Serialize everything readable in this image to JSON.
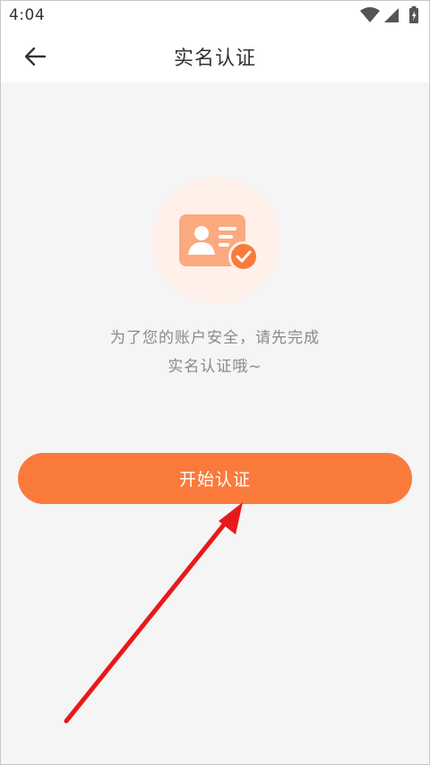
{
  "status_bar": {
    "time": "4:04",
    "icons": [
      "wifi-icon",
      "signal-icon",
      "battery-icon"
    ]
  },
  "nav": {
    "title": "实名认证",
    "back_icon": "arrow-left-icon"
  },
  "hero": {
    "icon": "id-card-check-icon"
  },
  "message": {
    "line1": "为了您的账户安全，请先完成",
    "line2": "实名认证哦~"
  },
  "actions": {
    "start_label": "开始认证"
  },
  "colors": {
    "accent": "#fa7a3c",
    "icon_circle_bg": "#fff0ea",
    "annotation_arrow": "#e8191b"
  }
}
